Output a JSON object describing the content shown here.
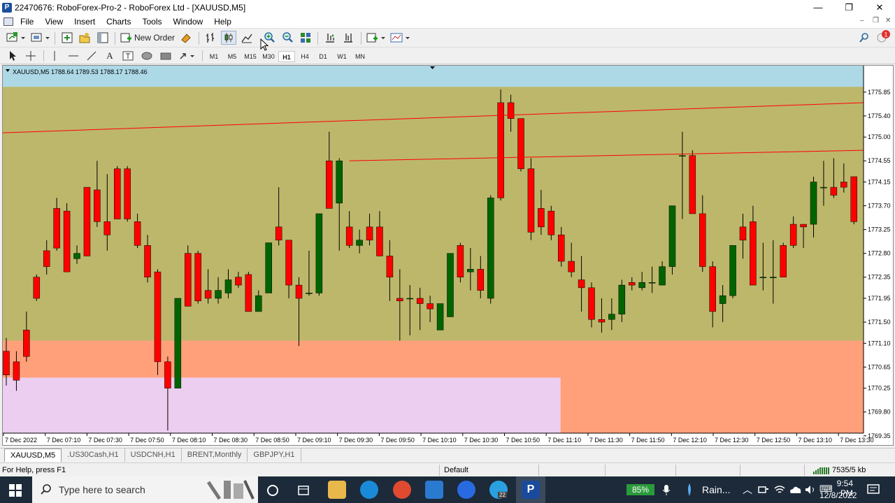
{
  "window": {
    "title": "22470676: RoboForex-Pro-2 - RoboForex Ltd - [XAUUSD,M5]",
    "app_icon": "P",
    "minimize_glyph": "—",
    "restore_glyph": "❐",
    "close_glyph": "✕"
  },
  "menu": [
    "File",
    "View",
    "Insert",
    "Charts",
    "Tools",
    "Window",
    "Help"
  ],
  "toolbar": {
    "new_order_label": "New Order",
    "notification_count": "1"
  },
  "timeframes": [
    "M1",
    "M5",
    "M15",
    "M30",
    "H1",
    "H4",
    "D1",
    "W1",
    "MN"
  ],
  "selected_timeframe": "H1",
  "chart": {
    "info": "XAUUSD,M5  1788.64 1789.53 1788.17 1788.46",
    "colors": {
      "background": "#bdb76b",
      "top_zone": "#add8e6",
      "orange_zone": "#ffa07a",
      "pink_zone": "#eccef0",
      "bull": "#006400",
      "bear": "#ff0000",
      "trendline": "#ff0000"
    }
  },
  "chart_data": {
    "type": "candlestick",
    "symbol": "XAUUSD",
    "ylim": [
      1769.4,
      1776.35
    ],
    "y_ticks": [
      "1775.85",
      "1775.40",
      "1775.00",
      "1774.55",
      "1774.15",
      "1773.70",
      "1773.25",
      "1772.80",
      "1772.35",
      "1771.95",
      "1771.50",
      "1771.10",
      "1770.65",
      "1770.25",
      "1769.80",
      "1769.35"
    ],
    "x_ticks": [
      "7 Dec 2022",
      "7 Dec 07:10",
      "7 Dec 07:30",
      "7 Dec 07:50",
      "7 Dec 08:10",
      "7 Dec 08:30",
      "7 Dec 08:50",
      "7 Dec 09:10",
      "7 Dec 09:30",
      "7 Dec 09:50",
      "7 Dec 10:10",
      "7 Dec 10:30",
      "7 Dec 10:50",
      "7 Dec 11:10",
      "7 Dec 11:30",
      "7 Dec 11:50",
      "7 Dec 12:10",
      "7 Dec 12:30",
      "7 Dec 12:50",
      "7 Dec 13:10",
      "7 Dec 13:30"
    ],
    "candles": [
      [
        1770.95,
        1771.2,
        1770.3,
        1770.5
      ],
      [
        1770.75,
        1770.95,
        1770.2,
        1770.4
      ],
      [
        1771.35,
        1771.7,
        1770.75,
        1770.85
      ],
      [
        1772.35,
        1772.4,
        1771.9,
        1771.95
      ],
      [
        1772.85,
        1773.05,
        1772.4,
        1772.55
      ],
      [
        1773.65,
        1773.85,
        1772.85,
        1772.9
      ],
      [
        1773.6,
        1773.75,
        1772.45,
        1772.45
      ],
      [
        1772.7,
        1772.95,
        1772.6,
        1772.8
      ],
      [
        1774.05,
        1774.05,
        1772.75,
        1772.75
      ],
      [
        1774.0,
        1774.55,
        1773.3,
        1773.4
      ],
      [
        1773.4,
        1774.3,
        1772.85,
        1773.15
      ],
      [
        1774.4,
        1774.45,
        1773.45,
        1773.45
      ],
      [
        1774.4,
        1774.45,
        1773.4,
        1773.45
      ],
      [
        1773.4,
        1773.55,
        1772.9,
        1772.95
      ],
      [
        1772.95,
        1773.15,
        1772.25,
        1772.35
      ],
      [
        1772.45,
        1772.5,
        1770.5,
        1770.75
      ],
      [
        1770.75,
        1770.85,
        1769.45,
        1770.25
      ],
      [
        1770.25,
        1771.95,
        1770.25,
        1771.95
      ],
      [
        1772.8,
        1772.95,
        1771.8,
        1771.8
      ],
      [
        1772.8,
        1772.85,
        1771.85,
        1771.9
      ],
      [
        1772.1,
        1772.5,
        1771.85,
        1771.95
      ],
      [
        1771.95,
        1772.35,
        1771.85,
        1772.1
      ],
      [
        1772.05,
        1772.5,
        1771.95,
        1772.3
      ],
      [
        1772.35,
        1772.45,
        1772.15,
        1772.2
      ],
      [
        1772.4,
        1772.45,
        1771.95,
        1771.7
      ],
      [
        1771.7,
        1772.1,
        1771.75,
        1772.0
      ],
      [
        1772.05,
        1772.95,
        1772.05,
        1773.0
      ],
      [
        1773.3,
        1774.05,
        1772.95,
        1773.05
      ],
      [
        1773.05,
        1773.05,
        1771.95,
        1772.2
      ],
      [
        1772.2,
        1772.35,
        1771.05,
        1771.95
      ],
      [
        1772.05,
        1772.85,
        1772.0,
        1772.05
      ],
      [
        1772.05,
        1773.4,
        1772.0,
        1773.55
      ],
      [
        1774.55,
        1775.1,
        1773.65,
        1773.65
      ],
      [
        1773.75,
        1774.6,
        1772.85,
        1774.55
      ],
      [
        1773.3,
        1773.6,
        1772.9,
        1772.95
      ],
      [
        1772.95,
        1773.25,
        1772.8,
        1773.05
      ],
      [
        1773.3,
        1773.55,
        1772.95,
        1773.05
      ],
      [
        1773.3,
        1773.6,
        1772.75,
        1772.75
      ],
      [
        1772.75,
        1773.05,
        1771.9,
        1772.35
      ],
      [
        1771.95,
        1772.5,
        1771.15,
        1771.9
      ],
      [
        1771.95,
        1772.2,
        1771.25,
        1771.95
      ],
      [
        1771.95,
        1772.15,
        1771.35,
        1771.85
      ],
      [
        1771.85,
        1772.0,
        1771.5,
        1771.75
      ],
      [
        1771.35,
        1771.75,
        1771.5,
        1771.85
      ],
      [
        1771.6,
        1772.65,
        1771.6,
        1772.8
      ],
      [
        1772.95,
        1773.0,
        1772.25,
        1772.35
      ],
      [
        1772.45,
        1772.9,
        1772.1,
        1772.5
      ],
      [
        1772.5,
        1772.75,
        1771.95,
        1772.1
      ],
      [
        1771.95,
        1773.9,
        1771.85,
        1773.85
      ],
      [
        1775.65,
        1775.9,
        1773.8,
        1773.85
      ],
      [
        1775.65,
        1775.8,
        1775.1,
        1775.35
      ],
      [
        1775.35,
        1775.3,
        1774.35,
        1774.4
      ],
      [
        1774.4,
        1774.6,
        1773.05,
        1773.2
      ],
      [
        1773.65,
        1774.0,
        1773.15,
        1773.3
      ],
      [
        1773.6,
        1773.7,
        1773.05,
        1773.15
      ],
      [
        1773.15,
        1773.3,
        1772.55,
        1772.65
      ],
      [
        1772.65,
        1773.0,
        1772.35,
        1772.45
      ],
      [
        1772.3,
        1772.75,
        1771.7,
        1772.15
      ],
      [
        1772.15,
        1772.25,
        1771.4,
        1771.55
      ],
      [
        1771.55,
        1771.95,
        1771.3,
        1771.5
      ],
      [
        1771.55,
        1771.95,
        1771.35,
        1771.65
      ],
      [
        1771.65,
        1772.3,
        1771.5,
        1772.2
      ],
      [
        1772.25,
        1772.35,
        1772.1,
        1772.2
      ],
      [
        1772.15,
        1772.45,
        1772.1,
        1772.25
      ],
      [
        1772.25,
        1772.55,
        1772.05,
        1772.25
      ],
      [
        1772.2,
        1772.65,
        1772.25,
        1772.55
      ],
      [
        1772.55,
        1773.6,
        1772.4,
        1773.7
      ],
      [
        1774.65,
        1775.1,
        1773.45,
        1774.65
      ],
      [
        1774.65,
        1774.75,
        1773.55,
        1773.55
      ],
      [
        1773.55,
        1773.9,
        1772.45,
        1772.55
      ],
      [
        1772.55,
        1772.65,
        1771.4,
        1771.7
      ],
      [
        1771.85,
        1772.2,
        1771.5,
        1772.0
      ],
      [
        1772.0,
        1772.7,
        1771.95,
        1772.95
      ],
      [
        1773.3,
        1773.55,
        1772.7,
        1773.05
      ],
      [
        1773.4,
        1773.7,
        1772.2,
        1772.2
      ],
      [
        1772.35,
        1773.0,
        1772.1,
        1772.35
      ],
      [
        1772.35,
        1773.05,
        1771.85,
        1772.35
      ],
      [
        1772.95,
        1773.0,
        1772.35,
        1772.35
      ],
      [
        1773.35,
        1773.5,
        1772.9,
        1772.95
      ],
      [
        1773.35,
        1773.35,
        1772.9,
        1773.3
      ],
      [
        1773.35,
        1774.25,
        1773.1,
        1774.15
      ],
      [
        1774.05,
        1774.55,
        1773.7,
        1774.05
      ],
      [
        1774.05,
        1774.6,
        1773.85,
        1773.9
      ],
      [
        1774.15,
        1774.5,
        1773.95,
        1774.05
      ],
      [
        1774.25,
        1774.15,
        1773.35,
        1773.4
      ]
    ],
    "trendlines": [
      {
        "from": [
          0,
          1775.08
        ],
        "to": [
          89,
          1775.65
        ]
      },
      {
        "from": [
          34,
          1774.55
        ],
        "to": [
          89,
          1774.75
        ]
      }
    ],
    "zones": [
      {
        "name": "top",
        "from": 1775.95,
        "to": 1776.35
      },
      {
        "name": "orange",
        "from": 1769.4,
        "to": 1771.15
      },
      {
        "name": "pink",
        "from": 1769.4,
        "to": 1770.45,
        "x_end_frac": 0.648
      }
    ]
  },
  "tabs": [
    {
      "label": "XAUUSD,M5",
      "active": true
    },
    {
      "label": ".US30Cash,H1",
      "active": false
    },
    {
      "label": "USDCNH,H1",
      "active": false
    },
    {
      "label": "BRENT,Monthly",
      "active": false
    },
    {
      "label": "GBPJPY,H1",
      "active": false
    }
  ],
  "status": {
    "help": "For Help, press F1",
    "profile": "Default",
    "traffic": "7535/5 kb"
  },
  "taskbar": {
    "search_placeholder": "Type here to search",
    "battery": "85%",
    "weather": "Rain...",
    "time": "9:54 PM",
    "date": "12/8/2022",
    "edge_badge": "22"
  }
}
